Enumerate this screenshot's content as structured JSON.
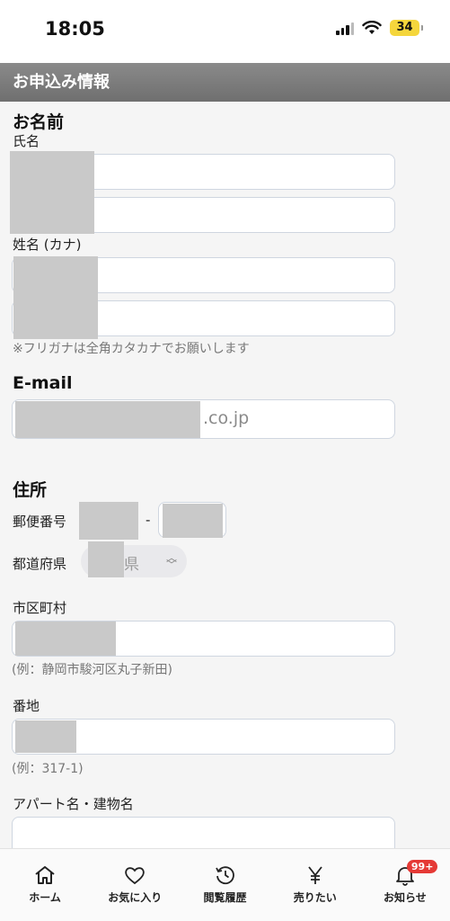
{
  "status": {
    "time": "18:05",
    "battery": "34"
  },
  "header": {
    "title": "お申込み情報"
  },
  "name_section": {
    "heading": "お名前",
    "kanji_label": "氏名",
    "kana_label": "姓名 (カナ)",
    "kana_hint": "※フリガナは全角カタカナでお願いします"
  },
  "email_section": {
    "heading": "E-mail",
    "value_suffix": ".co.jp"
  },
  "address_section": {
    "heading": "住所",
    "postal_label": "郵便番号",
    "postal_separator": "-",
    "prefecture_label": "都道府県",
    "prefecture_value_suffix": "県",
    "city_label": "市区町村",
    "city_hint": "(例：静岡市駿河区丸子新田)",
    "street_label": "番地",
    "street_hint": "(例：317-1)",
    "building_label": "アパート名・建物名"
  },
  "tab_bar": {
    "items": [
      {
        "label": "ホーム",
        "icon": "home-icon"
      },
      {
        "label": "お気に入り",
        "icon": "heart-icon"
      },
      {
        "label": "閲覧履歴",
        "icon": "history-icon"
      },
      {
        "label": "売りたい",
        "icon": "yen-icon"
      },
      {
        "label": "お知らせ",
        "icon": "bell-icon",
        "badge": "99+"
      }
    ]
  },
  "colors": {
    "header_bg": "#7a7a7a",
    "badge": "#e53935",
    "battery": "#f5d63c"
  }
}
